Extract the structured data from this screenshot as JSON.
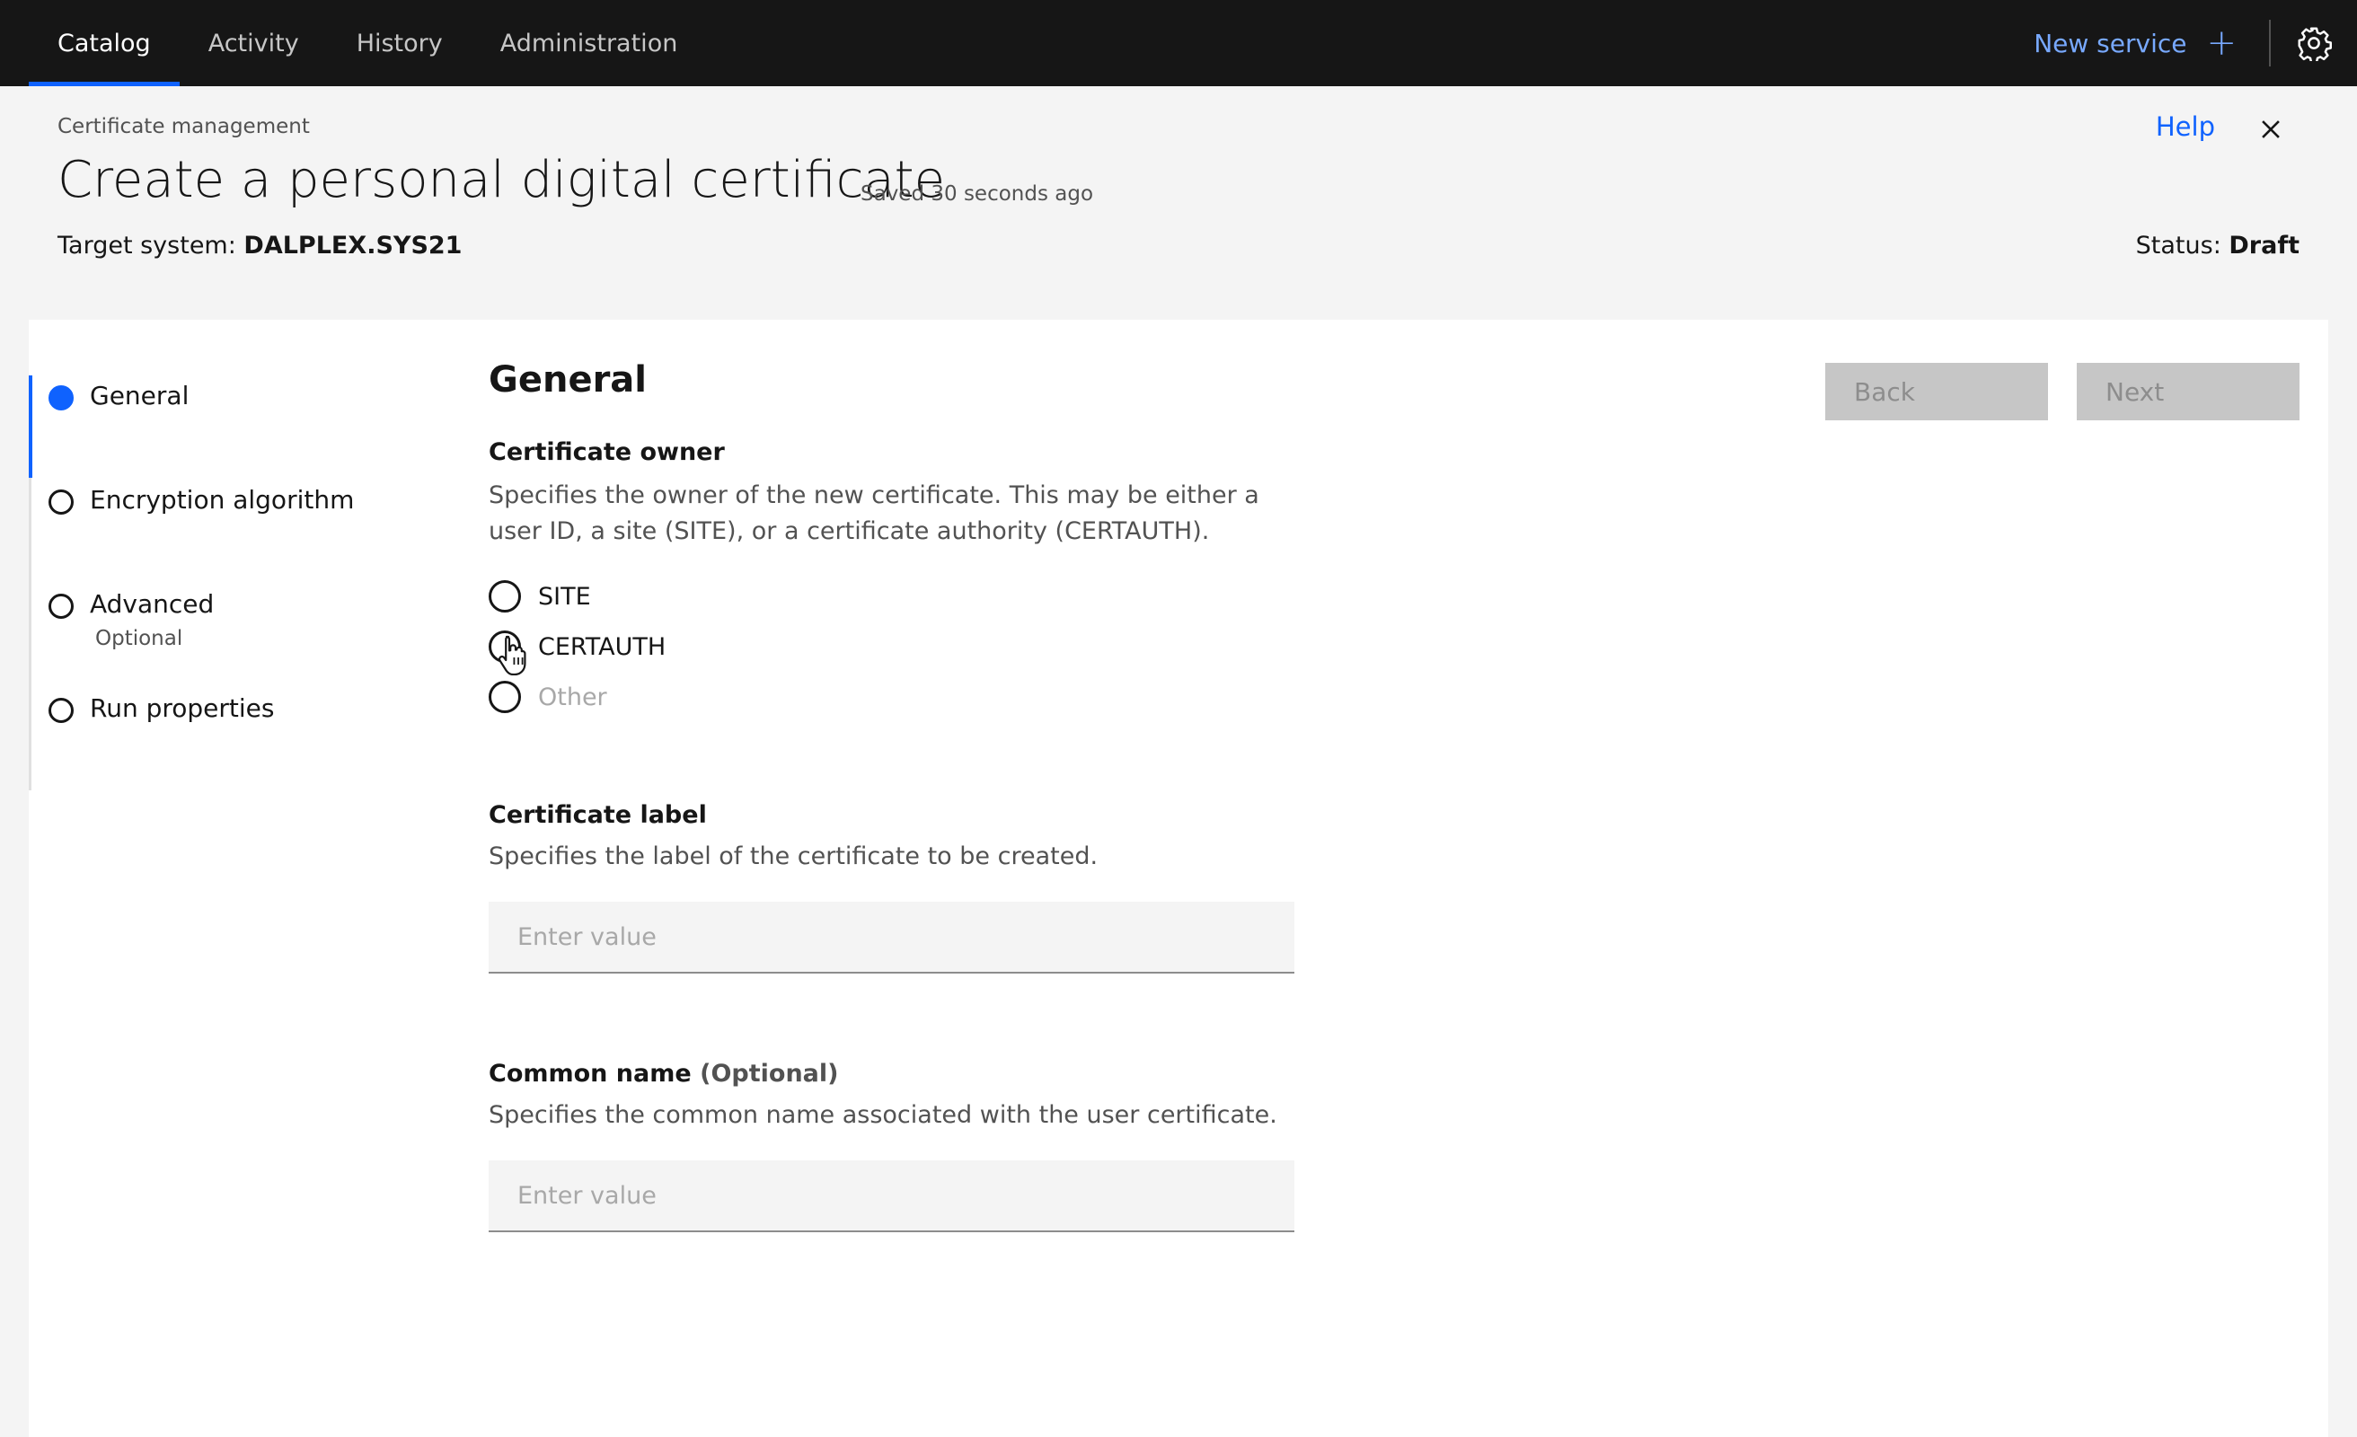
{
  "topnav": {
    "tabs": [
      {
        "label": "Catalog",
        "active": true
      },
      {
        "label": "Activity",
        "active": false
      },
      {
        "label": "History",
        "active": false
      },
      {
        "label": "Administration",
        "active": false
      }
    ],
    "new_service_label": "New service",
    "plus_icon": "+",
    "settings_icon": "gear-icon"
  },
  "header": {
    "breadcrumb": "Certificate management",
    "title": "Create a personal digital certificate",
    "saved_note": "Saved 30 seconds ago",
    "target_system_label": "Target system:",
    "target_system_value": "DALPLEX.SYS21",
    "help_label": "Help",
    "status_label": "Status:",
    "status_value": "Draft"
  },
  "progress": {
    "steps": [
      {
        "label": "General",
        "sub": "",
        "state": "current"
      },
      {
        "label": "Encryption algorithm",
        "sub": "",
        "state": "incomplete"
      },
      {
        "label": "Advanced",
        "sub": "Optional",
        "state": "incomplete"
      },
      {
        "label": "Run properties",
        "sub": "",
        "state": "incomplete"
      }
    ]
  },
  "form": {
    "section_title": "General",
    "owner": {
      "label": "Certificate owner",
      "help": "Specifies the owner of the new certificate. This may be either a user ID, a site (SITE), or a certificate authority (CERTAUTH).",
      "options": [
        {
          "label": "SITE",
          "disabled": false
        },
        {
          "label": "CERTAUTH",
          "disabled": false
        },
        {
          "label": "Other",
          "disabled": true
        }
      ]
    },
    "cert_label": {
      "label": "Certificate label",
      "help": "Specifies the label of the certificate to be created.",
      "placeholder": "Enter value",
      "value": ""
    },
    "common_name": {
      "label": "Common name",
      "optional": "(Optional)",
      "help": "Specifies the common name associated with the user certificate.",
      "placeholder": "Enter value",
      "value": ""
    }
  },
  "buttons": {
    "back_label": "Back",
    "next_label": "Next"
  },
  "colors": {
    "accent": "#0f62fe",
    "nav_bg": "#161616",
    "link_on_dark": "#78a9ff",
    "disabled_bg": "#c6c6c6"
  }
}
